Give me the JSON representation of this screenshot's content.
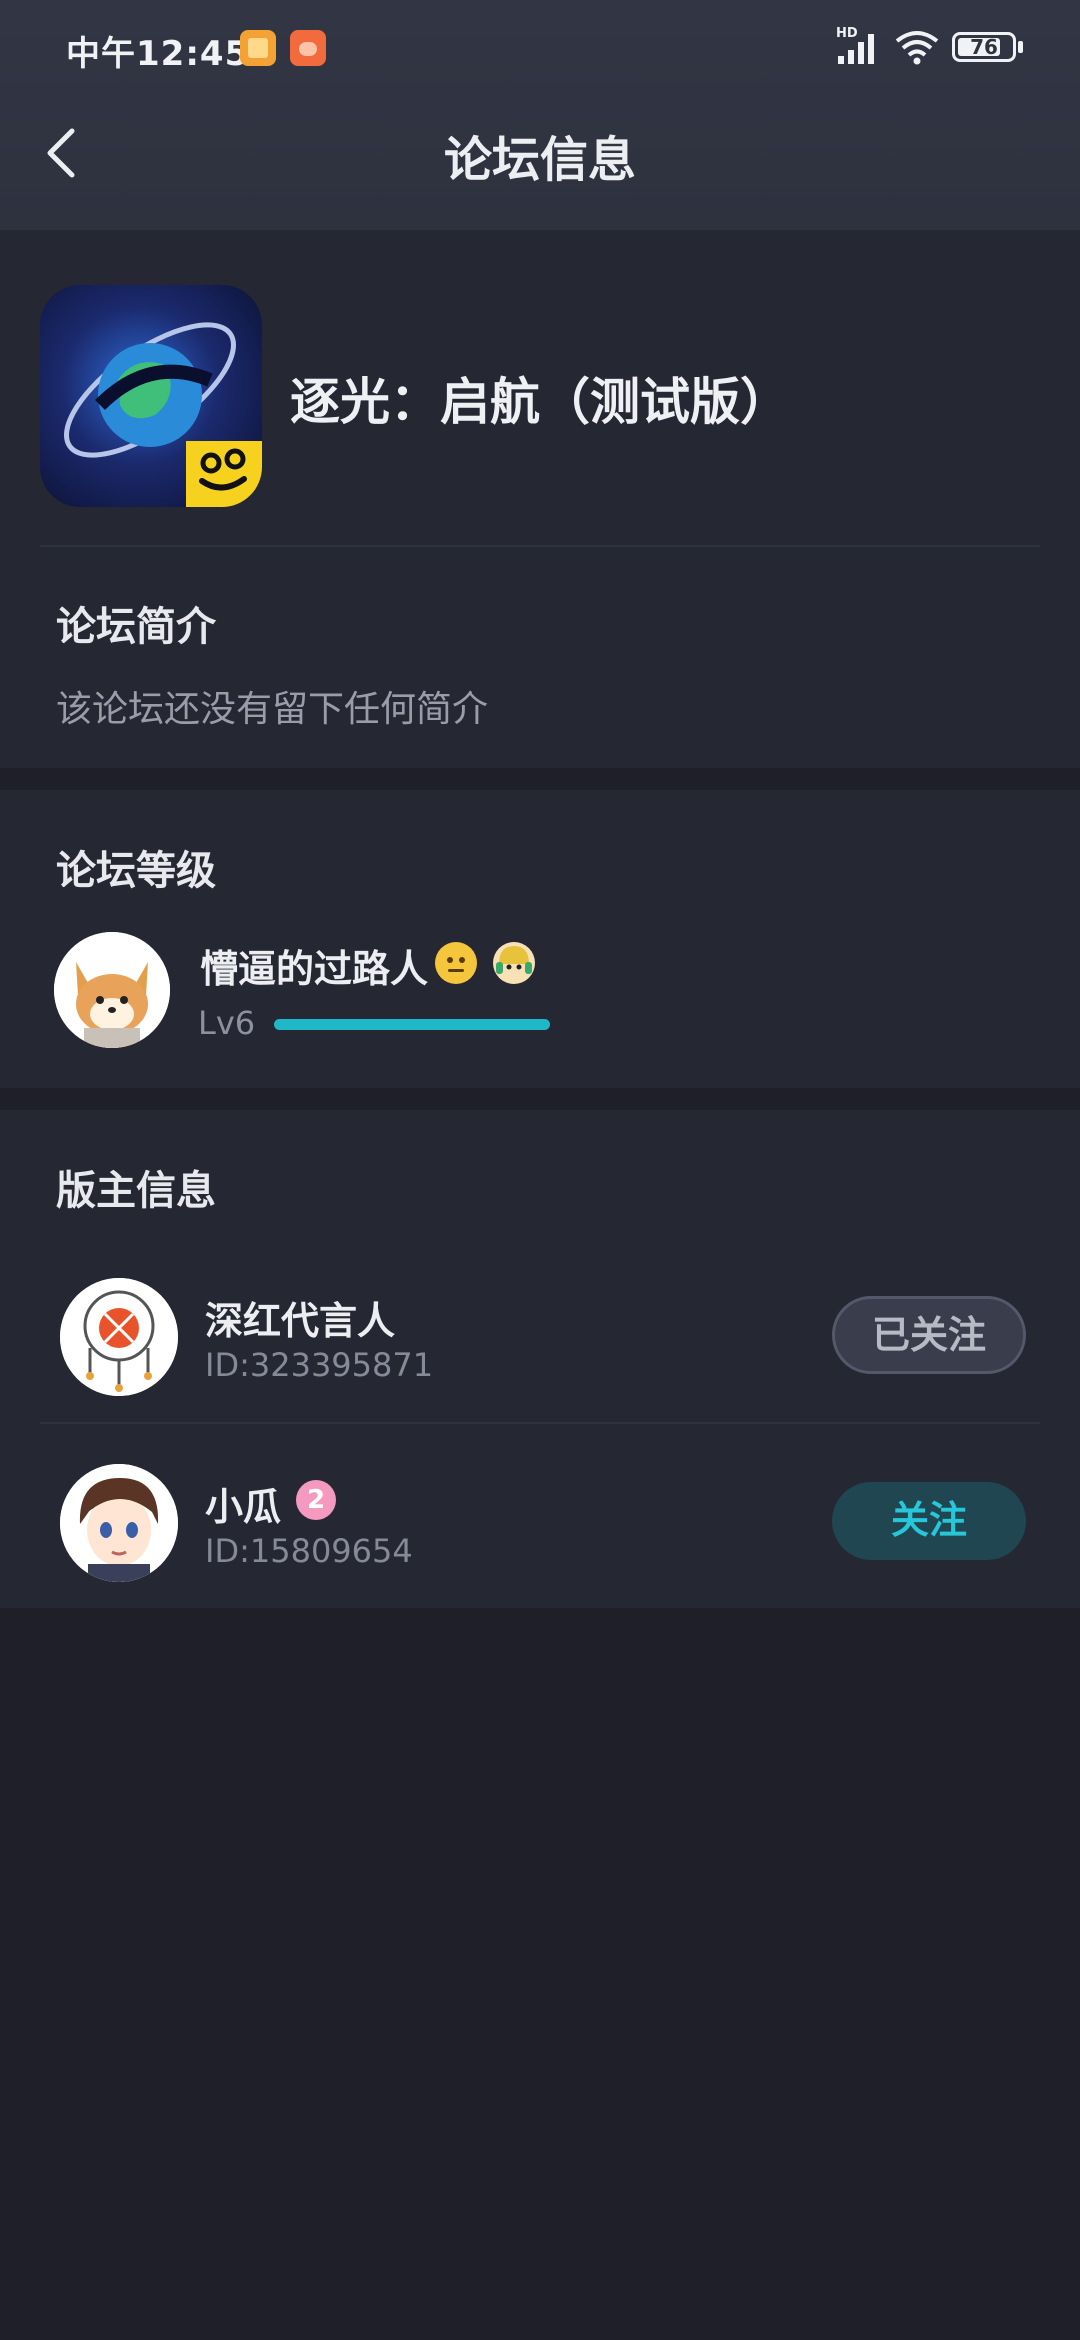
{
  "status_bar": {
    "time": "中午12:45",
    "signal_label": "HD",
    "battery_level": "76"
  },
  "header": {
    "title": "论坛信息",
    "back_icon": "chevron-left-icon"
  },
  "forum": {
    "name": "逐光：启航（测试版）",
    "intro_title": "论坛简介",
    "intro_text": "该论坛还没有留下任何简介"
  },
  "level": {
    "section_title": "论坛等级",
    "user_name": "懵逼的过路人",
    "level_label": "Lv6",
    "progress": 1.0,
    "accent": "#1fb8c9"
  },
  "moderators": {
    "section_title": "版主信息",
    "items": [
      {
        "name": "深红代言人",
        "id": "ID:323395871",
        "button": "已关注"
      },
      {
        "name": "小瓜",
        "id": "ID:15809654",
        "button": "关注",
        "badge": "2"
      }
    ]
  }
}
